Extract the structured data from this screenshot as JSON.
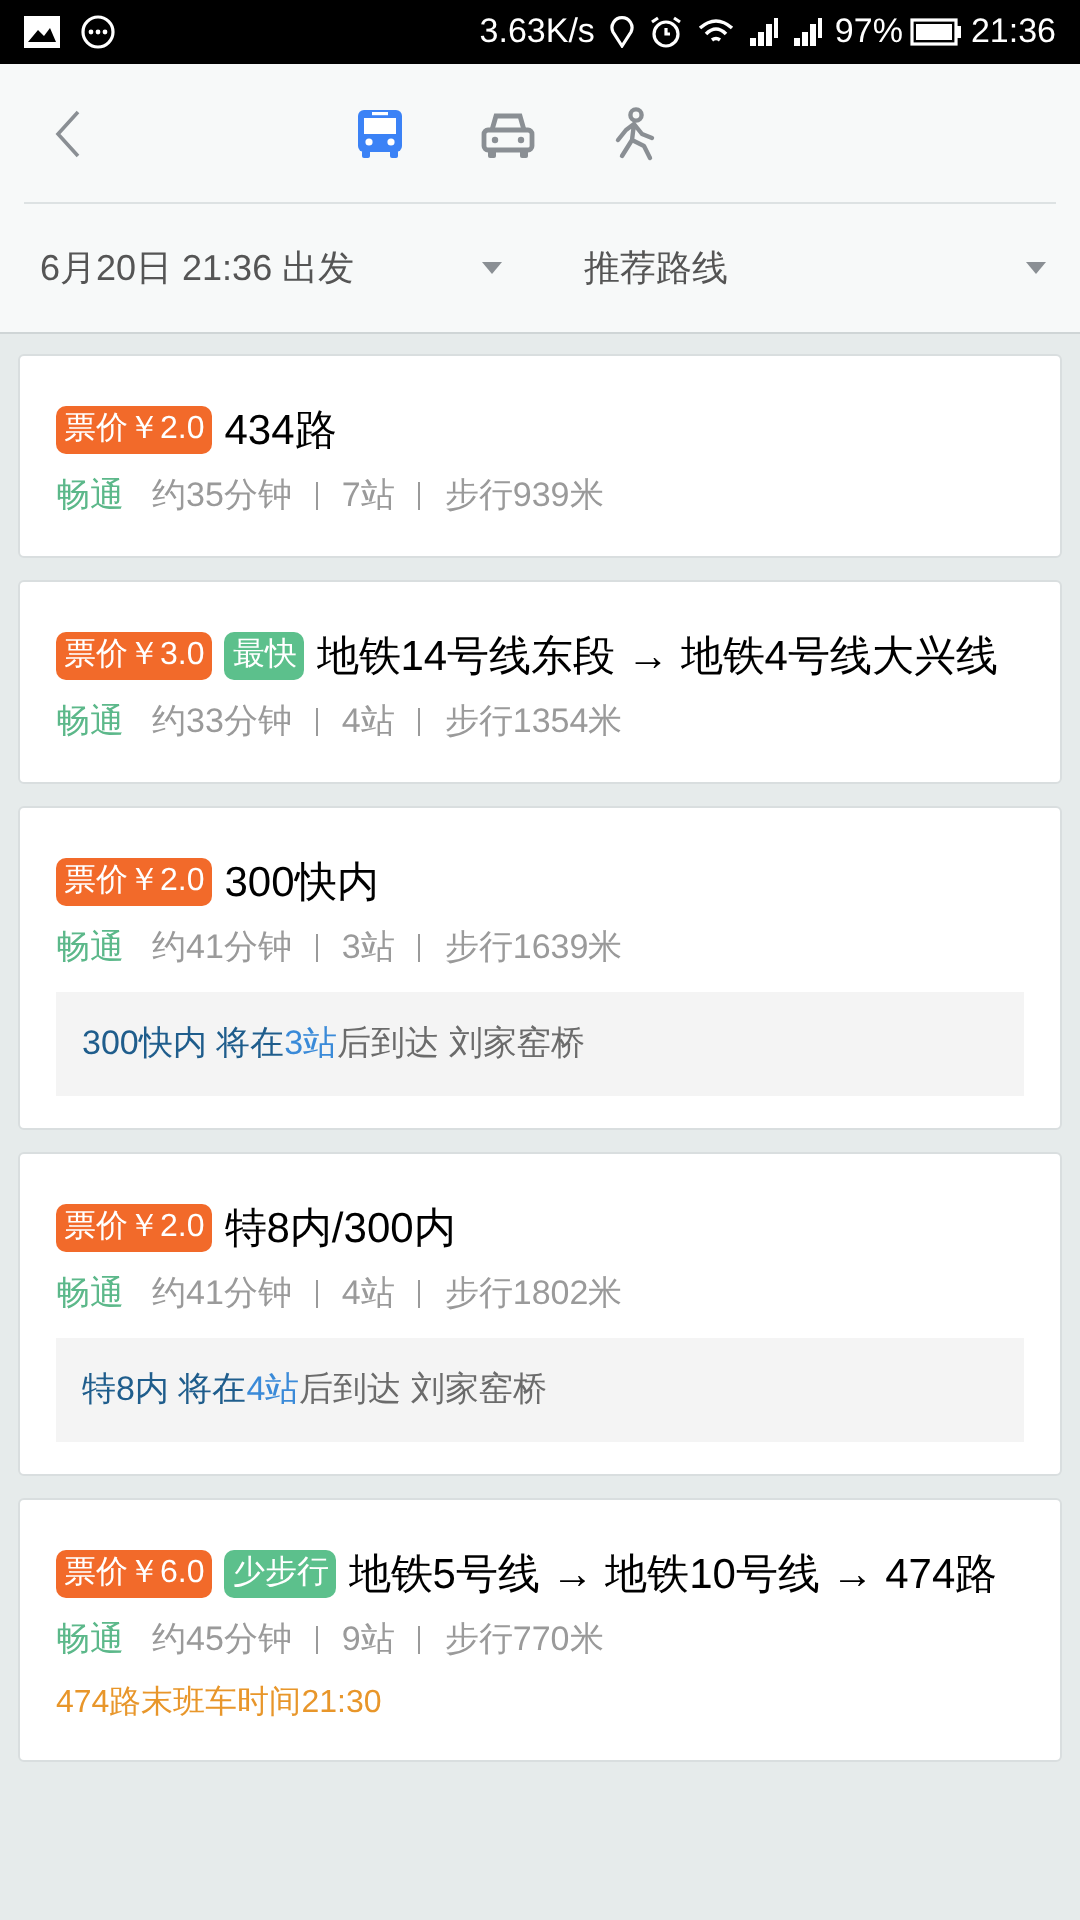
{
  "status_bar": {
    "speed": "3.63K/s",
    "battery": "97%",
    "time": "21:36"
  },
  "modes": [
    {
      "kind": "bus",
      "selected": true
    },
    {
      "kind": "car",
      "selected": false
    },
    {
      "kind": "walk",
      "selected": false
    }
  ],
  "filters": [
    {
      "label": "6月20日 21:36 出发"
    },
    {
      "label": "推荐路线"
    }
  ],
  "routes": [
    {
      "badges": [
        {
          "kind": "price",
          "text": "票价￥2.0"
        }
      ],
      "title": "434路",
      "traffic": "畅通",
      "duration": "约35分钟",
      "stops": "7站",
      "walk": "步行939米"
    },
    {
      "badges": [
        {
          "kind": "price",
          "text": "票价￥3.0"
        },
        {
          "kind": "tag",
          "text": "最快"
        }
      ],
      "title": "地铁14号线东段 → 地铁4号线大兴线",
      "traffic": "畅通",
      "duration": "约33分钟",
      "stops": "4站",
      "walk": "步行1354米"
    },
    {
      "badges": [
        {
          "kind": "price",
          "text": "票价￥2.0"
        }
      ],
      "title": "300快内",
      "traffic": "畅通",
      "duration": "约41分钟",
      "stops": "3站",
      "walk": "步行1639米",
      "notice": [
        {
          "kind": "line",
          "text": "300快内 将在"
        },
        {
          "kind": "count",
          "text": "3站"
        },
        {
          "kind": "plain",
          "text": "后到达 刘家窑桥"
        }
      ]
    },
    {
      "badges": [
        {
          "kind": "price",
          "text": "票价￥2.0"
        }
      ],
      "title": "特8内/300内",
      "traffic": "畅通",
      "duration": "约41分钟",
      "stops": "4站",
      "walk": "步行1802米",
      "notice": [
        {
          "kind": "line",
          "text": "特8内 将在"
        },
        {
          "kind": "count",
          "text": "4站"
        },
        {
          "kind": "plain",
          "text": "后到达 刘家窑桥"
        }
      ]
    },
    {
      "badges": [
        {
          "kind": "price",
          "text": "票价￥6.0"
        },
        {
          "kind": "tag",
          "text": "少步行"
        }
      ],
      "title": "地铁5号线 → 地铁10号线 → 474路",
      "traffic": "畅通",
      "duration": "约45分钟",
      "stops": "9站",
      "walk": "步行770米",
      "alert": "474路末班车时间21:30"
    }
  ]
}
